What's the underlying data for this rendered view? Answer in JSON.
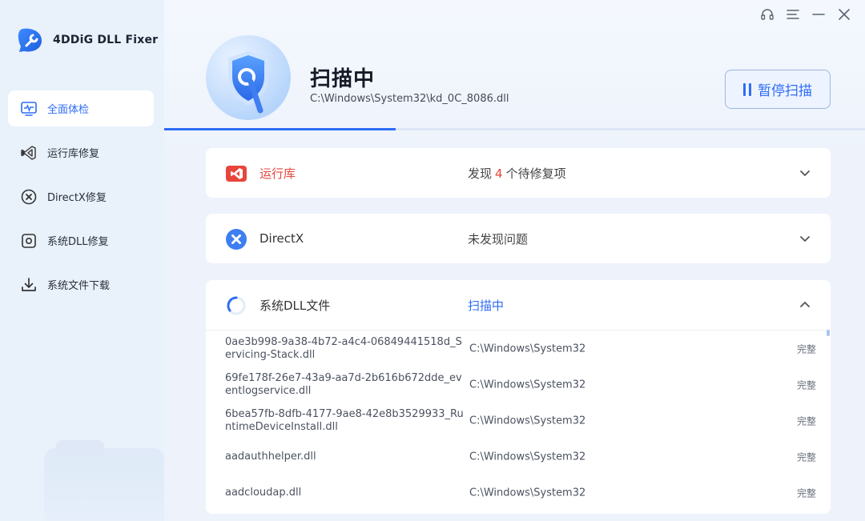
{
  "app": {
    "name": "4DDiG DLL Fixer"
  },
  "sidebar": {
    "items": [
      {
        "label": "全面体检",
        "icon": "monitor-pulse-icon",
        "active": true
      },
      {
        "label": "运行库修复",
        "icon": "visual-studio-icon",
        "active": false
      },
      {
        "label": "DirectX修复",
        "icon": "directx-icon",
        "active": false
      },
      {
        "label": "系统DLL修复",
        "icon": "gear-box-icon",
        "active": false
      },
      {
        "label": "系统文件下载",
        "icon": "download-icon",
        "active": false
      }
    ]
  },
  "window_controls": [
    "headset-icon",
    "menu-icon",
    "minimize-icon",
    "close-icon"
  ],
  "scan": {
    "title": "扫描中",
    "current_file": "C:\\Windows\\System32\\kd_0C_8086.dll",
    "pause_label": "暂停扫描",
    "progress_percent": 33
  },
  "cards": {
    "runtime": {
      "name": "运行库",
      "status_prefix": "发现",
      "count": "4",
      "status_suffix": "个待修复项"
    },
    "directx": {
      "name": "DirectX",
      "status": "未发现问题"
    },
    "sysdll": {
      "name": "系统DLL文件",
      "status": "扫描中"
    }
  },
  "dll_rows": [
    {
      "name": "0ae3b998-9a38-4b72-a4c4-06849441518d_Servicing-Stack.dll",
      "path": "C:\\Windows\\System32",
      "state": "完整"
    },
    {
      "name": "69fe178f-26e7-43a9-aa7d-2b616b672dde_eventlogservice.dll",
      "path": "C:\\Windows\\System32",
      "state": "完整"
    },
    {
      "name": "6bea57fb-8dfb-4177-9ae8-42e8b3529933_RuntimeDeviceInstall.dll",
      "path": "C:\\Windows\\System32",
      "state": "完整"
    },
    {
      "name": "aadauthhelper.dll",
      "path": "C:\\Windows\\System32",
      "state": "完整"
    },
    {
      "name": "aadcloudap.dll",
      "path": "C:\\Windows\\System32",
      "state": "完整"
    }
  ],
  "colors": {
    "accent": "#2d6cf6",
    "danger": "#e8453c",
    "sidebar_bg": "#e9f1fb"
  }
}
